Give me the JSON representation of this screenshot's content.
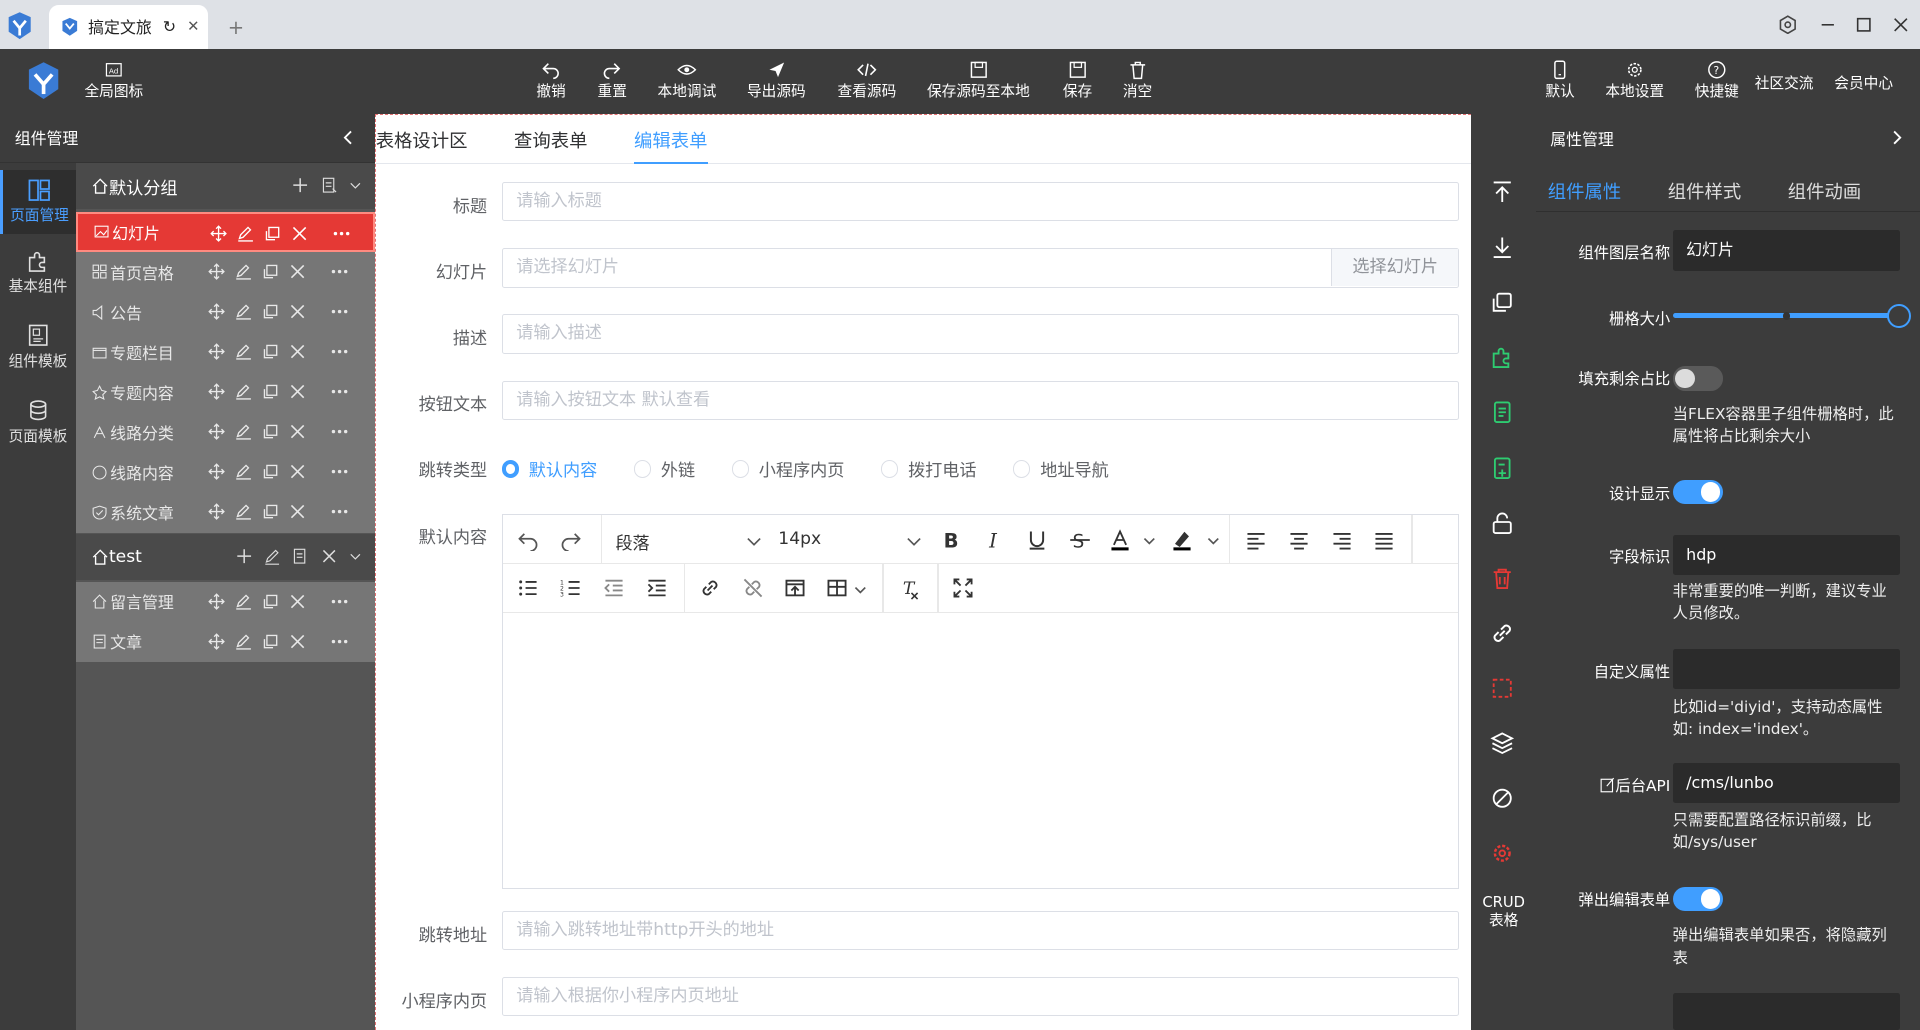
{
  "browser": {
    "tab_title": "搞定文旅"
  },
  "toolbar": {
    "global_icon": "全局图标",
    "undo": "撤销",
    "reset": "重置",
    "local_debug": "本地调试",
    "export_source": "导出源码",
    "view_source": "查看源码",
    "save_source_local": "保存源码至本地",
    "save": "保存",
    "clear": "消空",
    "default": "默认",
    "local_settings": "本地设置",
    "shortcuts": "快捷键",
    "community": "社区交流",
    "member_center": "会员中心"
  },
  "left_panel": {
    "title": "组件管理",
    "rail": [
      "页面管理",
      "基本组件",
      "组件模板",
      "页面模板"
    ],
    "groups": [
      {
        "name": "默认分组",
        "items": [
          "幻灯片",
          "首页宫格",
          "公告",
          "专题栏目",
          "专题内容",
          "线路分类",
          "线路内容",
          "系统文章"
        ]
      },
      {
        "name": "test",
        "items": [
          "留言管理",
          "文章"
        ]
      }
    ]
  },
  "canvas": {
    "tabs": [
      "表格设计区",
      "查询表单",
      "编辑表单"
    ],
    "active_tab": "编辑表单",
    "fields": {
      "title": {
        "label": "标题",
        "placeholder": "请输入标题"
      },
      "slide": {
        "label": "幻灯片",
        "placeholder": "请选择幻灯片",
        "button": "选择幻灯片"
      },
      "desc": {
        "label": "描述",
        "placeholder": "请输入描述"
      },
      "button_text": {
        "label": "按钮文本",
        "placeholder": "请输入按钮文本 默认查看"
      },
      "jump_type": {
        "label": "跳转类型",
        "options": [
          "默认内容",
          "外链",
          "小程序内页",
          "拨打电话",
          "地址导航"
        ],
        "selected": "默认内容"
      },
      "default_content": {
        "label": "默认内容"
      },
      "jump_url": {
        "label": "跳转地址",
        "placeholder": "请输入跳转地址带http开头的地址"
      },
      "mini_page": {
        "label": "小程序内页",
        "placeholder": "请输入根据你小程序内页地址"
      }
    },
    "editor": {
      "block_format": "段落",
      "font_size": "14px"
    }
  },
  "right_tools": {
    "crud": "CRUD表格"
  },
  "right_panel": {
    "title": "属性管理",
    "tabs": [
      "组件属性",
      "组件样式",
      "组件动画"
    ],
    "active_tab": "组件属性",
    "props": {
      "layer_name": {
        "label": "组件图层名称",
        "value": "幻灯片"
      },
      "grid_size": {
        "label": "栅格大小",
        "value": 1.0
      },
      "fill_rest": {
        "label": "填充剩余占比",
        "on": false,
        "hint": "当FLEX容器里子组件栅格时，此属性将占比剩余大小"
      },
      "design_show": {
        "label": "设计显示",
        "on": true
      },
      "field_id": {
        "label": "字段标识",
        "value": "hdp",
        "hint": "非常重要的唯一判断，建议专业人员修改。"
      },
      "custom_attr": {
        "label": "自定义属性",
        "value": "",
        "hint": "比如id='diyid'，支持动态属性如: index='index'。"
      },
      "backend_api": {
        "label": "后台API",
        "value": "/cms/lunbo",
        "hint": "只需要配置路径标识前缀，比如/sys/user"
      },
      "popup_edit": {
        "label": "弹出编辑表单",
        "on": true,
        "hint": "弹出编辑表单如果否，将隐藏列表"
      }
    }
  },
  "colors": {
    "accent": "#409eff",
    "active_row": "#e53935",
    "dark_bg": "#3c3c3c"
  }
}
